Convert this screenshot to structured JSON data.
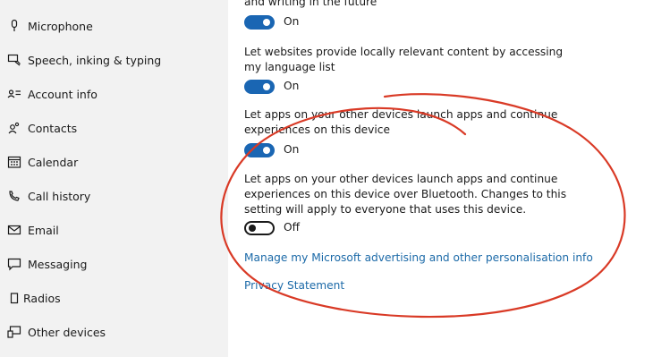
{
  "sidebar": {
    "items": [
      {
        "label": "Microphone",
        "icon": "microphone-icon"
      },
      {
        "label": "Speech, inking & typing",
        "icon": "speech-inking-icon"
      },
      {
        "label": "Account info",
        "icon": "account-info-icon"
      },
      {
        "label": "Contacts",
        "icon": "contacts-icon"
      },
      {
        "label": "Calendar",
        "icon": "calendar-icon"
      },
      {
        "label": "Call history",
        "icon": "call-history-icon"
      },
      {
        "label": "Email",
        "icon": "email-icon"
      },
      {
        "label": "Messaging",
        "icon": "messaging-icon"
      },
      {
        "label": "Radios",
        "icon": "radios-icon"
      },
      {
        "label": "Other devices",
        "icon": "other-devices-icon"
      }
    ]
  },
  "main": {
    "partial_heading": "and writing in the future",
    "settings": [
      {
        "description": "",
        "state": "On",
        "enabled": true
      },
      {
        "description": "Let websites provide locally relevant content by accessing my language list",
        "state": "On",
        "enabled": true
      },
      {
        "description": "Let apps on your other devices launch apps and continue experiences on this device",
        "state": "On",
        "enabled": true
      },
      {
        "description": "Let apps on your other devices launch apps and continue experiences on this device over Bluetooth. Changes to this setting will apply to everyone that uses this device.",
        "state": "Off",
        "enabled": false
      }
    ],
    "links": {
      "manage_advertising": "Manage my Microsoft advertising and other personalisation info",
      "privacy_statement": "Privacy Statement"
    }
  },
  "colors": {
    "sidebar_bg": "#f2f2f2",
    "toggle_on": "#1a66b3",
    "link": "#1c6aa8",
    "annotation_red": "#d93a26"
  }
}
